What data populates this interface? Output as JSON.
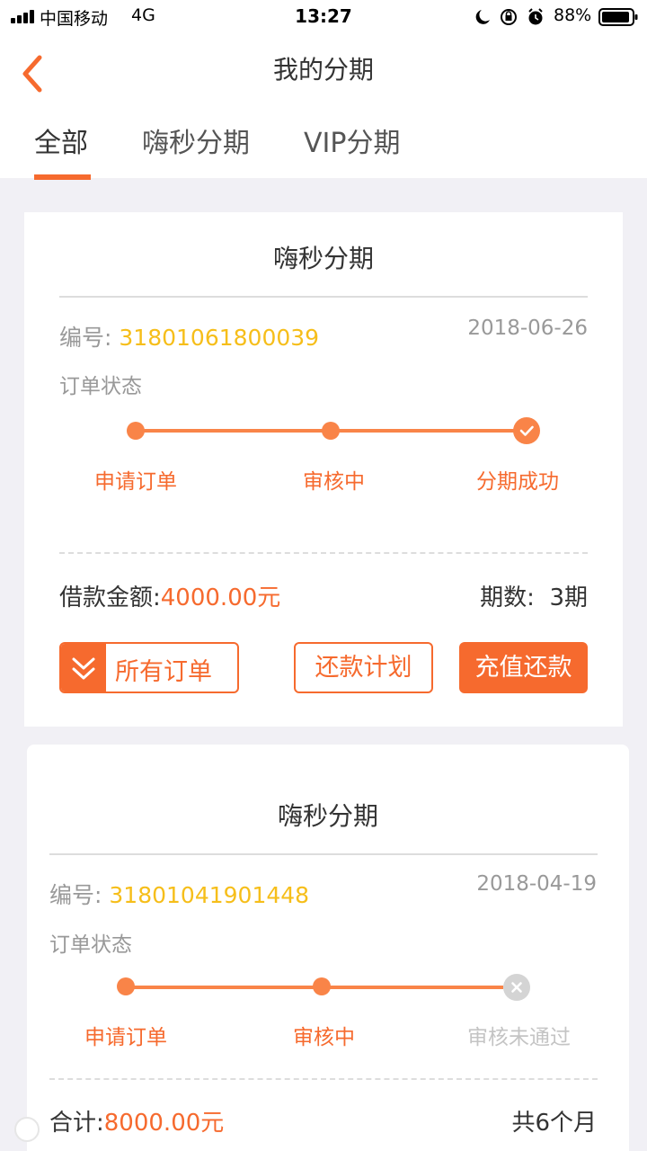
{
  "status_bar": {
    "carrier": "中国移动",
    "network": "4G",
    "time": "13:27",
    "battery_pct": "88%"
  },
  "header": {
    "title": "我的分期",
    "tabs": [
      {
        "label": "全部",
        "active": true
      },
      {
        "label": "嗨秒分期",
        "active": false
      },
      {
        "label": "VIP分期",
        "active": false
      }
    ]
  },
  "orders": [
    {
      "title": "嗨秒分期",
      "order_no_label": "编号:",
      "order_no": "31801061800039",
      "date": "2018-06-26",
      "state_label": "订单状态",
      "steps": [
        "申请订单",
        "审核中",
        "分期成功"
      ],
      "amount_label": "借款金额:",
      "amount": "4000.00元",
      "period_label": "期数:",
      "period": "3期",
      "buttons": {
        "all_orders": "所有订单",
        "repay_plan": "还款计划",
        "recharge_repay": "充值还款"
      }
    },
    {
      "title": "嗨秒分期",
      "order_no_label": "编号:",
      "order_no": "31801041901448",
      "date": "2018-04-19",
      "state_label": "订单状态",
      "steps": [
        "申请订单",
        "审核中",
        "审核未通过"
      ],
      "total_label": "合计:",
      "total": "8000.00元",
      "months": "共6个月"
    }
  ],
  "colors": {
    "accent": "#f66a2e",
    "order_number": "#f6be1a",
    "page_bg": "#f1f0f5"
  }
}
